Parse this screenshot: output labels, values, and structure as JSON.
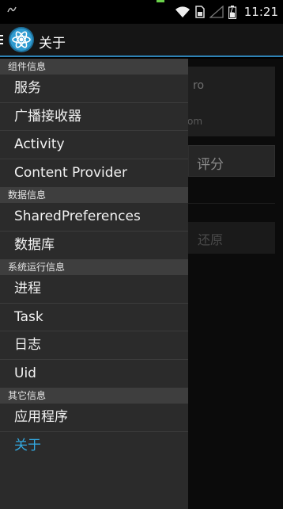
{
  "status_bar": {
    "time": "11:21",
    "icons": [
      "notification-icon",
      "wifi-icon",
      "sim-icon",
      "signal-icon",
      "battery-icon"
    ]
  },
  "action_bar": {
    "title": "关于",
    "icon": "atom-app-icon"
  },
  "drawer": {
    "sections": [
      {
        "header": "组件信息",
        "items": [
          "服务",
          "广播接收器",
          "Activity",
          "Content Provider"
        ]
      },
      {
        "header": "数据信息",
        "items": [
          "SharedPreferences",
          "数据库"
        ]
      },
      {
        "header": "系统运行信息",
        "items": [
          "进程",
          "Task",
          "日志",
          "Uid"
        ]
      },
      {
        "header": "其它信息",
        "items": [
          "应用程序",
          "关于"
        ]
      }
    ],
    "active_item": "关于"
  },
  "background": {
    "card_text_1": "ro",
    "card_text_2": "om",
    "rate_button": "评分",
    "restore_button": "还原"
  },
  "colors": {
    "accent": "#33a8e0",
    "drawer_bg": "#2b2b2b",
    "section_bg": "#3e3e3e",
    "actionbar_line": "#2e83b6"
  }
}
